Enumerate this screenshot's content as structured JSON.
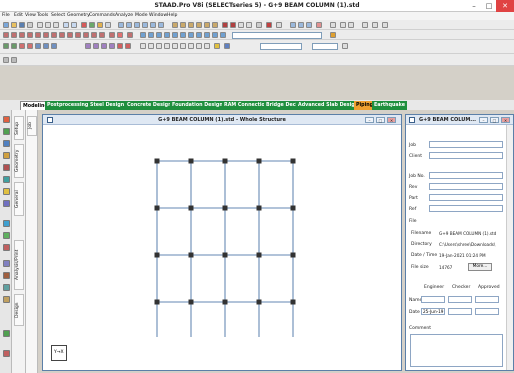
{
  "window": {
    "title": "STAAD.Pro V8i (SELECTseries 5) - G+9 BEAM COLUMN (1).std",
    "min": "–",
    "max": "□",
    "close": "✕"
  },
  "menu": [
    "File",
    "Edit",
    "View",
    "Tools",
    "Select",
    "Geometry",
    "Commands",
    "Analyze",
    "Mode",
    "Window",
    "Help"
  ],
  "ribbon_tabs": [
    "Modeling",
    "Postprocessing",
    "Steel Design",
    "Concrete Design",
    "Foundation Design",
    "RAM Connection",
    "Bridge Deck",
    "Advanced Slab Design",
    "Piping",
    "Earthquake"
  ],
  "vertical_tabs": [
    "Setup",
    "Geometry",
    "General",
    "Analysis/Print",
    "Design"
  ],
  "vertical_tab_top": "Job",
  "structure_window": {
    "title": "G+9 BEAM COLUMN (1).std - Whole Structure",
    "axis": "Y→X"
  },
  "job_panel": {
    "title": "G+9 BEAM COLUM...",
    "labels": {
      "job": "Job",
      "client": "Client",
      "job_no": "Job No.",
      "rev": "Rev",
      "part": "Part",
      "ref": "Ref",
      "file": "File",
      "filename": "Filename",
      "directory": "Directory",
      "datetime": "Date / Time",
      "filesize": "File size",
      "engineer": "Engineer",
      "checker": "Checker",
      "approved": "Approved",
      "name": "Name",
      "date": "Date",
      "comment": "Comment"
    },
    "values": {
      "filename": "G+9 BEAM COLUMN (1).std",
      "directory": "C:\\Users\\shree\\Downloads\\",
      "datetime": "19-Jan-2021   01:24 PM",
      "filesize": "14767",
      "date": "25-Jun-19"
    },
    "more_button": "More..."
  },
  "colors": {
    "ribbon_green": "#1f8f3e",
    "grid_line": "#2f5f9a",
    "node": "#333333"
  },
  "structure": {
    "columns": 5,
    "rows": 4
  }
}
